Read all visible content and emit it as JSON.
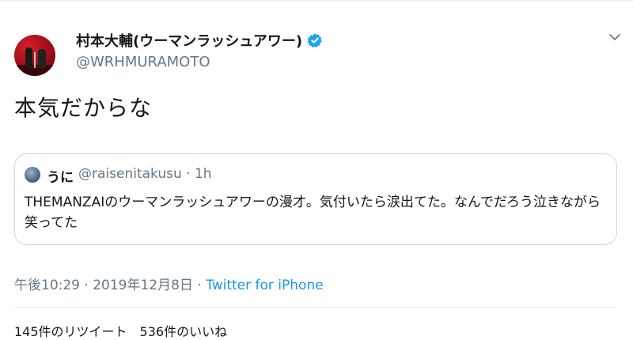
{
  "tweet": {
    "display_name": "村本大輔(ウーマンラッシュアワー)",
    "handle": "@WRHMURAMOTO",
    "text": "本気だからな",
    "timestamp": "午後10:29 · 2019年12月8日 · ",
    "source": "Twitter for iPhone",
    "stats": "145件のリツイート　536件のいいね"
  },
  "quoted": {
    "name": "うに",
    "handle_time": "@raisenitakusu · 1h",
    "text": "THEMANZAIのウーマンラッシュアワーの漫才。気付いたら涙出てた。なんでだろう泣きながら笑ってた"
  },
  "colors": {
    "accent": "#1da1f2",
    "link": "#1b95e0",
    "secondary_text": "#657786",
    "border": "#ccd6dd"
  },
  "icons": [
    "verified-badge-icon",
    "chevron-down-icon"
  ]
}
